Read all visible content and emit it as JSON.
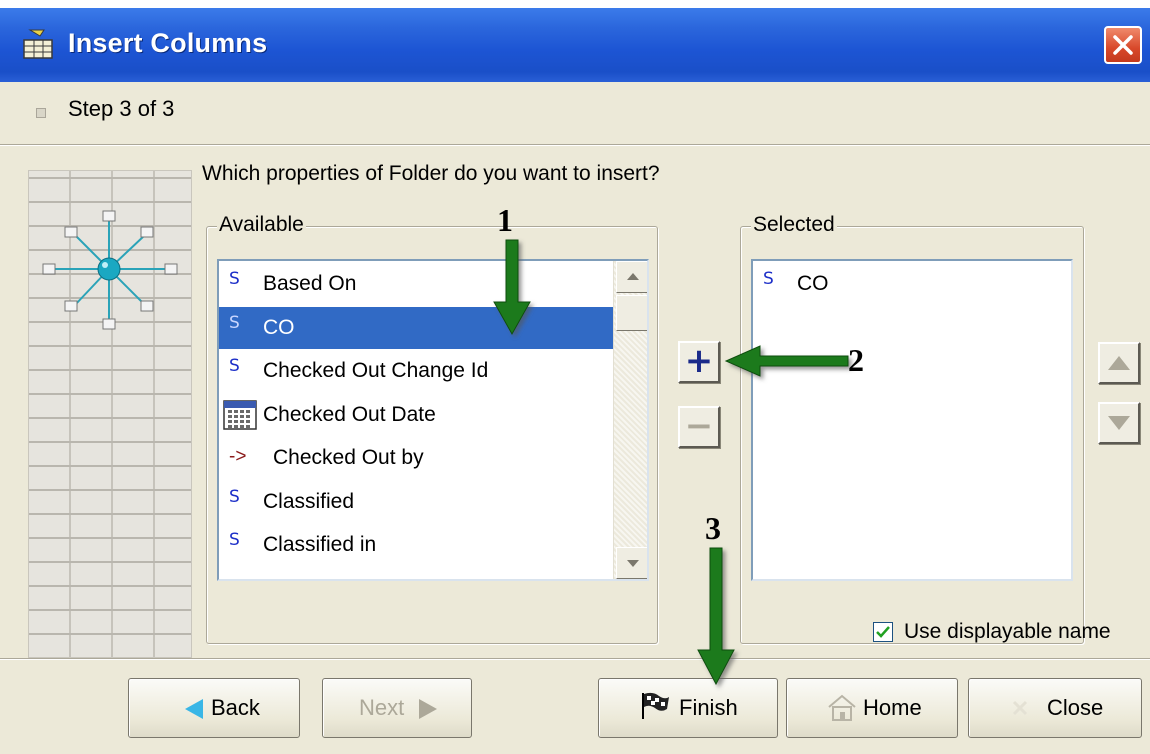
{
  "window": {
    "title": "Insert Columns",
    "icons": {
      "title": "table-insert-icon",
      "close": "close-icon"
    },
    "colors": {
      "titlebar": "#1d55d4",
      "close": "#d8482a",
      "selection": "#316ac5",
      "body": "#ece9d8"
    }
  },
  "step": {
    "text": "Step 3 of 3"
  },
  "question": "Which properties of Folder do you want to insert?",
  "available": {
    "label": "Available",
    "items": [
      {
        "icon": "s-type-icon",
        "glyph": "S",
        "label": "Based On",
        "selected": false
      },
      {
        "icon": "s-type-icon",
        "glyph": "S",
        "label": "CO",
        "selected": true
      },
      {
        "icon": "s-type-icon",
        "glyph": "S",
        "label": "Checked Out Change Id",
        "selected": false
      },
      {
        "icon": "calendar-icon",
        "glyph": "",
        "label": "Checked Out Date",
        "selected": false
      },
      {
        "icon": "reference-arrow-icon",
        "glyph": "->",
        "label": "Checked Out by",
        "selected": false
      },
      {
        "icon": "s-type-icon",
        "glyph": "S",
        "label": "Classified",
        "selected": false
      },
      {
        "icon": "s-type-icon",
        "glyph": "S",
        "label": "Classified in",
        "selected": false
      }
    ]
  },
  "selected": {
    "label": "Selected",
    "items": [
      {
        "icon": "s-type-icon",
        "glyph": "S",
        "label": "CO"
      }
    ]
  },
  "controls": {
    "add": "+",
    "remove": "−",
    "move_up": "move-up-icon",
    "move_down": "move-down-icon"
  },
  "use_displayable_name": {
    "label": "Use displayable name",
    "checked": true
  },
  "buttons": {
    "back": "Back",
    "next": "Next",
    "finish": "Finish",
    "home": "Home",
    "close": "Close"
  },
  "annotations": [
    "1",
    "2",
    "3"
  ]
}
